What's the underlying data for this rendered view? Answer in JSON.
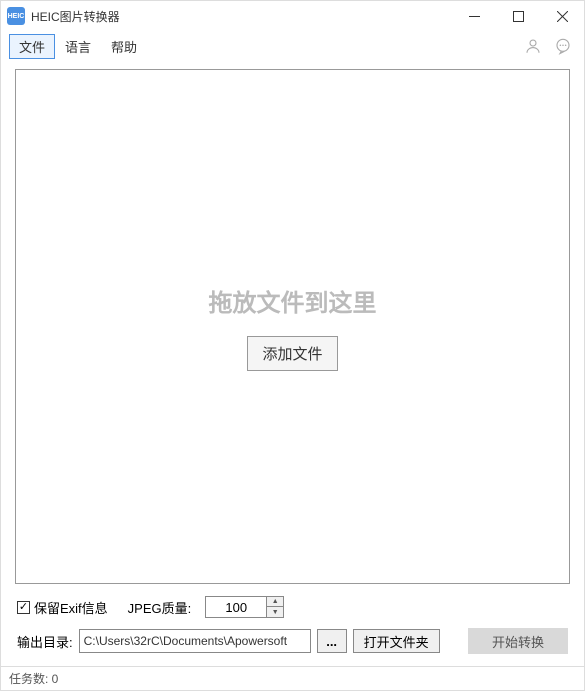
{
  "titlebar": {
    "app_icon_text": "HEIC",
    "title": "HEIC图片转换器"
  },
  "menu": {
    "file": "文件",
    "language": "语言",
    "help": "帮助"
  },
  "dropzone": {
    "hint": "拖放文件到这里",
    "add_button": "添加文件"
  },
  "settings": {
    "keep_exif_label": "保留Exif信息",
    "keep_exif_checked": "✓",
    "quality_label": "JPEG质量:",
    "quality_value": "100"
  },
  "output": {
    "label": "输出目录:",
    "path": "C:\\Users\\32rC\\Documents\\Apowersoft",
    "browse": "...",
    "open_folder": "打开文件夹",
    "start": "开始转换"
  },
  "status": {
    "task_count_label": "任务数: 0"
  }
}
